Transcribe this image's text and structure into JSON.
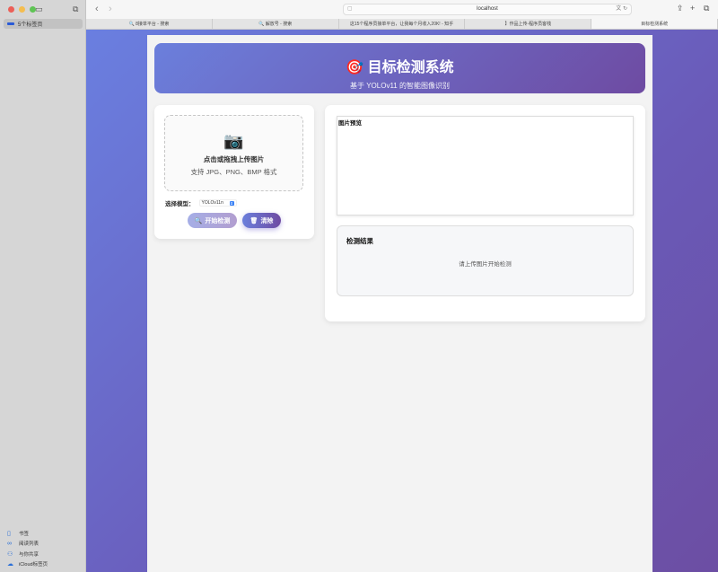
{
  "sidebar": {
    "tab_group": "5个标签页",
    "bottom": [
      "书签",
      "阅读列表",
      "与你共享",
      "iCloud标签页"
    ]
  },
  "toolbar": {
    "url": "localhost"
  },
  "tabs": [
    "8接单平台 - 搜索",
    "解放号 - 搜索",
    "这15个程序员接单平台，让我每个月收入20K! - 知乎",
    "】作品上传-程序员客栈",
    "目标检测系统"
  ],
  "header": {
    "icon": "🎯",
    "title": "目标检测系统",
    "subtitle": "基于 YOLOv11 的智能图像识别"
  },
  "upload": {
    "icon": "📷",
    "title": "点击或拖拽上传图片",
    "formats": "支持 JPG、PNG、BMP 格式"
  },
  "model": {
    "label": "选择模型：",
    "value": "YOLOv11n"
  },
  "buttons": {
    "detect": "开始检测",
    "clear": "清除"
  },
  "preview": {
    "title": "图片预览"
  },
  "results": {
    "title": "检测结果",
    "empty": "请上传图片开始检测"
  }
}
